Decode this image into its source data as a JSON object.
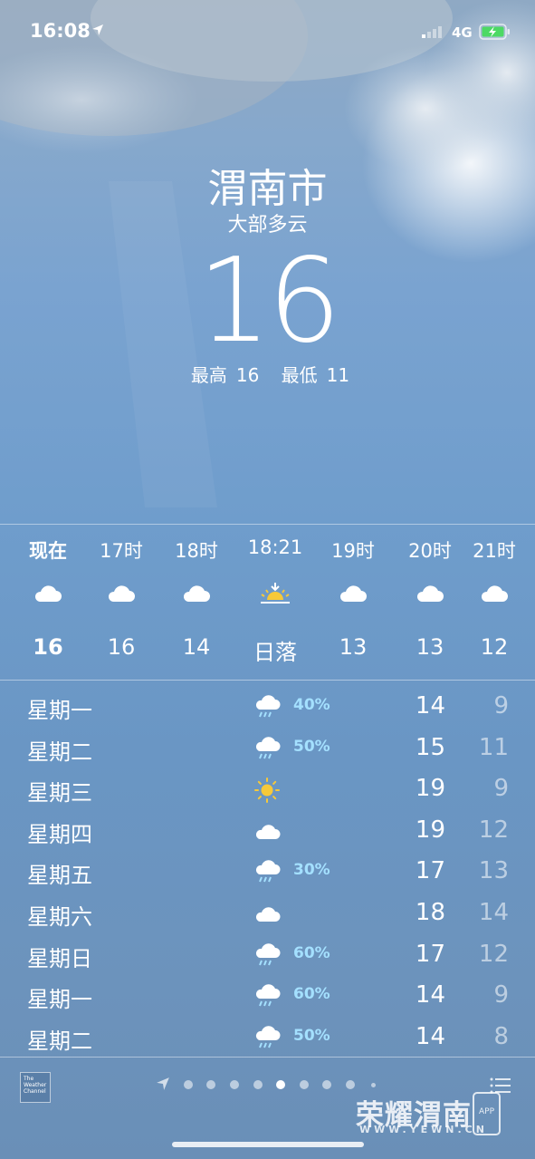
{
  "status_bar": {
    "time": "16:08",
    "network": "4G"
  },
  "location": {
    "city": "渭南市",
    "condition": "大部多云",
    "temperature": "16",
    "high_label": "最高",
    "high": "16",
    "low_label": "最低",
    "low": "11"
  },
  "hourly": [
    {
      "label": "现在",
      "icon": "cloud-icon",
      "value": "16"
    },
    {
      "label": "17时",
      "icon": "cloud-icon",
      "value": "16"
    },
    {
      "label": "18时",
      "icon": "cloud-icon",
      "value": "14"
    },
    {
      "label": "18:21",
      "icon": "sunset-icon",
      "value": "日落"
    },
    {
      "label": "19时",
      "icon": "cloud-icon",
      "value": "13"
    },
    {
      "label": "20时",
      "icon": "cloud-icon",
      "value": "13"
    },
    {
      "label": "21时",
      "icon": "cloud-icon",
      "value": "12"
    }
  ],
  "daily": [
    {
      "day": "星期一",
      "icon": "rain-cloud-icon",
      "chance": "40%",
      "high": "14",
      "low": "9"
    },
    {
      "day": "星期二",
      "icon": "rain-cloud-icon",
      "chance": "50%",
      "high": "15",
      "low": "11"
    },
    {
      "day": "星期三",
      "icon": "sun-icon",
      "chance": "",
      "high": "19",
      "low": "9"
    },
    {
      "day": "星期四",
      "icon": "cloud-icon",
      "chance": "",
      "high": "19",
      "low": "12"
    },
    {
      "day": "星期五",
      "icon": "rain-cloud-icon",
      "chance": "30%",
      "high": "17",
      "low": "13"
    },
    {
      "day": "星期六",
      "icon": "cloud-icon",
      "chance": "",
      "high": "18",
      "low": "14"
    },
    {
      "day": "星期日",
      "icon": "rain-cloud-icon",
      "chance": "60%",
      "high": "17",
      "low": "12"
    },
    {
      "day": "星期一",
      "icon": "rain-cloud-icon",
      "chance": "60%",
      "high": "14",
      "low": "9"
    },
    {
      "day": "星期二",
      "icon": "rain-cloud-icon",
      "chance": "50%",
      "high": "14",
      "low": "8"
    }
  ],
  "footer": {
    "provider_logo": "The Weather Channel",
    "page_count": 9,
    "active_page": 5,
    "watermark": "荣耀渭南",
    "watermark_sub": "WWW.YEWN.CN",
    "app_badge": "APP"
  },
  "colors": {
    "precip": "#a4e0ff",
    "sun": "#f6c93a"
  }
}
